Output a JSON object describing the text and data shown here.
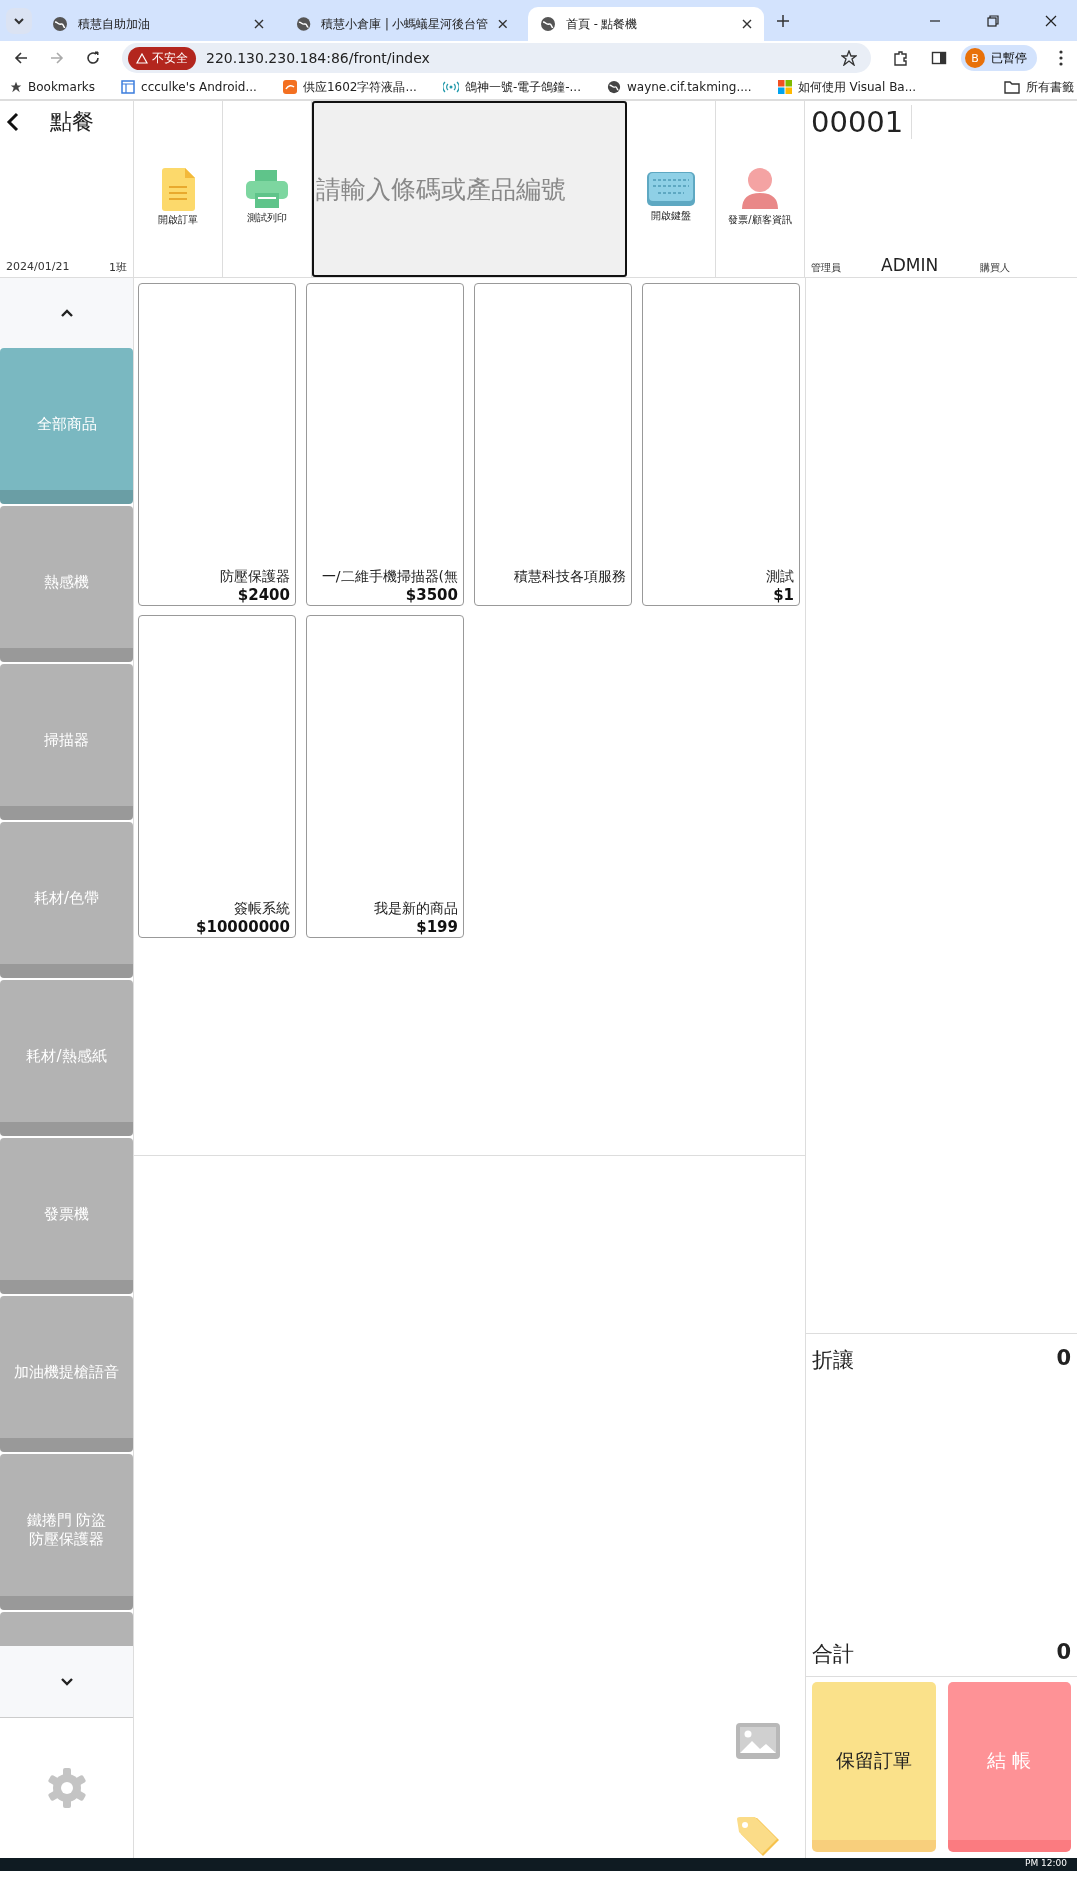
{
  "browser": {
    "tabs": [
      {
        "title": "積慧自助加油",
        "selected": false
      },
      {
        "title": "積慧小倉庫 | 小螞蟻星河後台管",
        "selected": false
      },
      {
        "title": "首頁 - 點餐機",
        "selected": true
      }
    ],
    "security_label": "不安全",
    "url": "220.130.230.184:86/front/index",
    "profile_initial": "B",
    "profile_label": "已暫停",
    "bookmarks": [
      {
        "label": "Bookmarks",
        "kind": "star"
      },
      {
        "label": "ccculke's Android...",
        "kind": "page"
      },
      {
        "label": "供应1602字符液晶...",
        "kind": "orange"
      },
      {
        "label": "鴿神一號-電子鴿鐘-...",
        "kind": "signal"
      },
      {
        "label": "wayne.cif.takming....",
        "kind": "globe"
      },
      {
        "label": "如何使用 Visual Ba...",
        "kind": "windows"
      }
    ],
    "all_bookmarks": "所有書籤"
  },
  "header": {
    "title": "點餐",
    "date": "2024/01/21",
    "shift": "1班",
    "tools_left": [
      {
        "label": "開啟訂單",
        "kind": "document"
      },
      {
        "label": "測試列印",
        "kind": "printer"
      }
    ],
    "search": {
      "placeholder": "請輸入條碼或產品編號"
    },
    "tools_right": [
      {
        "label": "開啟鍵盤",
        "kind": "keyboard"
      },
      {
        "label": "發票/顧客資訊",
        "kind": "person"
      }
    ]
  },
  "order": {
    "number": "00001",
    "staff_label": "管理員",
    "staff_name": "ADMIN",
    "buyer_label": "購買人",
    "discount_label": "折讓",
    "discount": "0",
    "total_label": "合計",
    "total": "0"
  },
  "categories": [
    {
      "label": "全部商品",
      "selected": true
    },
    {
      "label": "熱感機",
      "selected": false
    },
    {
      "label": "掃描器",
      "selected": false
    },
    {
      "label": "耗材/色帶",
      "selected": false
    },
    {
      "label": "耗材/熱感紙",
      "selected": false
    },
    {
      "label": "發票機",
      "selected": false
    },
    {
      "label": "加油機提槍語音",
      "selected": false
    },
    {
      "label": "鐵捲門 防盜防壓保護器",
      "selected": false
    }
  ],
  "products": [
    {
      "name": "防壓保護器",
      "price": "$2400"
    },
    {
      "name": "一/二維手機掃描器(無",
      "price": "$3500"
    },
    {
      "name": "積慧科技各項服務"
    },
    {
      "name": "測試",
      "price": "$1"
    },
    {
      "name": "簽帳系統",
      "price": "$10000000"
    },
    {
      "name": "我是新的商品",
      "price": "$199"
    }
  ],
  "actions": [
    {
      "label": "保留訂單",
      "kind": "hold"
    },
    {
      "label": "結 帳",
      "kind": "checkout"
    }
  ],
  "taskbar": {
    "clock": "PM 12:00"
  }
}
